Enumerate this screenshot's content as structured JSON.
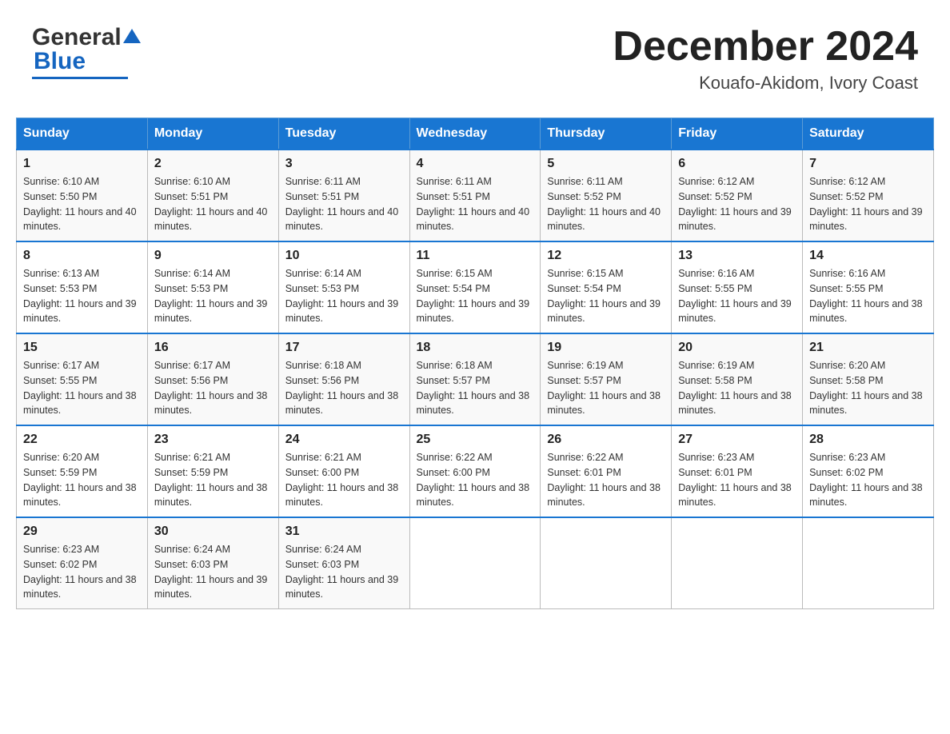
{
  "header": {
    "logo_text_black": "General",
    "logo_text_blue": "Blue",
    "month_title": "December 2024",
    "location": "Kouafo-Akidom, Ivory Coast"
  },
  "days_of_week": [
    "Sunday",
    "Monday",
    "Tuesday",
    "Wednesday",
    "Thursday",
    "Friday",
    "Saturday"
  ],
  "weeks": [
    [
      {
        "day": 1,
        "sunrise": "6:10 AM",
        "sunset": "5:50 PM",
        "daylight": "11 hours and 40 minutes."
      },
      {
        "day": 2,
        "sunrise": "6:10 AM",
        "sunset": "5:51 PM",
        "daylight": "11 hours and 40 minutes."
      },
      {
        "day": 3,
        "sunrise": "6:11 AM",
        "sunset": "5:51 PM",
        "daylight": "11 hours and 40 minutes."
      },
      {
        "day": 4,
        "sunrise": "6:11 AM",
        "sunset": "5:51 PM",
        "daylight": "11 hours and 40 minutes."
      },
      {
        "day": 5,
        "sunrise": "6:11 AM",
        "sunset": "5:52 PM",
        "daylight": "11 hours and 40 minutes."
      },
      {
        "day": 6,
        "sunrise": "6:12 AM",
        "sunset": "5:52 PM",
        "daylight": "11 hours and 39 minutes."
      },
      {
        "day": 7,
        "sunrise": "6:12 AM",
        "sunset": "5:52 PM",
        "daylight": "11 hours and 39 minutes."
      }
    ],
    [
      {
        "day": 8,
        "sunrise": "6:13 AM",
        "sunset": "5:53 PM",
        "daylight": "11 hours and 39 minutes."
      },
      {
        "day": 9,
        "sunrise": "6:14 AM",
        "sunset": "5:53 PM",
        "daylight": "11 hours and 39 minutes."
      },
      {
        "day": 10,
        "sunrise": "6:14 AM",
        "sunset": "5:53 PM",
        "daylight": "11 hours and 39 minutes."
      },
      {
        "day": 11,
        "sunrise": "6:15 AM",
        "sunset": "5:54 PM",
        "daylight": "11 hours and 39 minutes."
      },
      {
        "day": 12,
        "sunrise": "6:15 AM",
        "sunset": "5:54 PM",
        "daylight": "11 hours and 39 minutes."
      },
      {
        "day": 13,
        "sunrise": "6:16 AM",
        "sunset": "5:55 PM",
        "daylight": "11 hours and 39 minutes."
      },
      {
        "day": 14,
        "sunrise": "6:16 AM",
        "sunset": "5:55 PM",
        "daylight": "11 hours and 38 minutes."
      }
    ],
    [
      {
        "day": 15,
        "sunrise": "6:17 AM",
        "sunset": "5:55 PM",
        "daylight": "11 hours and 38 minutes."
      },
      {
        "day": 16,
        "sunrise": "6:17 AM",
        "sunset": "5:56 PM",
        "daylight": "11 hours and 38 minutes."
      },
      {
        "day": 17,
        "sunrise": "6:18 AM",
        "sunset": "5:56 PM",
        "daylight": "11 hours and 38 minutes."
      },
      {
        "day": 18,
        "sunrise": "6:18 AM",
        "sunset": "5:57 PM",
        "daylight": "11 hours and 38 minutes."
      },
      {
        "day": 19,
        "sunrise": "6:19 AM",
        "sunset": "5:57 PM",
        "daylight": "11 hours and 38 minutes."
      },
      {
        "day": 20,
        "sunrise": "6:19 AM",
        "sunset": "5:58 PM",
        "daylight": "11 hours and 38 minutes."
      },
      {
        "day": 21,
        "sunrise": "6:20 AM",
        "sunset": "5:58 PM",
        "daylight": "11 hours and 38 minutes."
      }
    ],
    [
      {
        "day": 22,
        "sunrise": "6:20 AM",
        "sunset": "5:59 PM",
        "daylight": "11 hours and 38 minutes."
      },
      {
        "day": 23,
        "sunrise": "6:21 AM",
        "sunset": "5:59 PM",
        "daylight": "11 hours and 38 minutes."
      },
      {
        "day": 24,
        "sunrise": "6:21 AM",
        "sunset": "6:00 PM",
        "daylight": "11 hours and 38 minutes."
      },
      {
        "day": 25,
        "sunrise": "6:22 AM",
        "sunset": "6:00 PM",
        "daylight": "11 hours and 38 minutes."
      },
      {
        "day": 26,
        "sunrise": "6:22 AM",
        "sunset": "6:01 PM",
        "daylight": "11 hours and 38 minutes."
      },
      {
        "day": 27,
        "sunrise": "6:23 AM",
        "sunset": "6:01 PM",
        "daylight": "11 hours and 38 minutes."
      },
      {
        "day": 28,
        "sunrise": "6:23 AM",
        "sunset": "6:02 PM",
        "daylight": "11 hours and 38 minutes."
      }
    ],
    [
      {
        "day": 29,
        "sunrise": "6:23 AM",
        "sunset": "6:02 PM",
        "daylight": "11 hours and 38 minutes."
      },
      {
        "day": 30,
        "sunrise": "6:24 AM",
        "sunset": "6:03 PM",
        "daylight": "11 hours and 39 minutes."
      },
      {
        "day": 31,
        "sunrise": "6:24 AM",
        "sunset": "6:03 PM",
        "daylight": "11 hours and 39 minutes."
      },
      null,
      null,
      null,
      null
    ]
  ]
}
